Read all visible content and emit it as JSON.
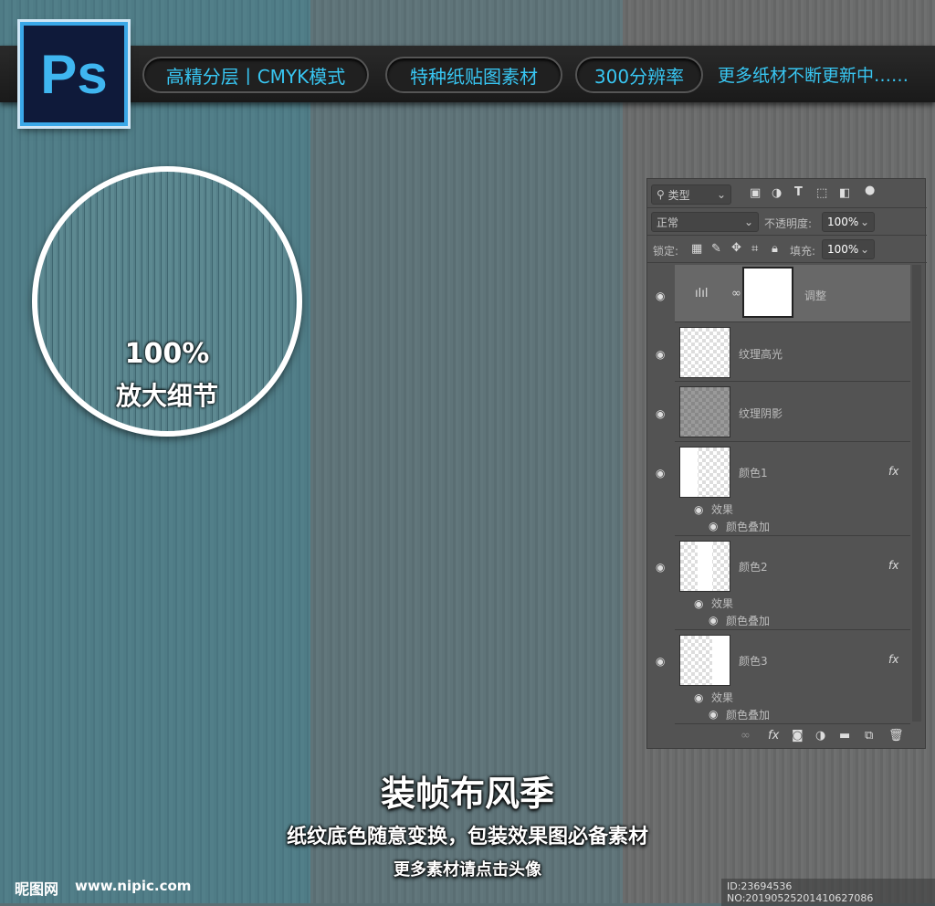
{
  "banner": {
    "logo": "Ps",
    "pills": [
      "高精分层丨CMYK模式",
      "特种纸贴图素材",
      "300分辨率"
    ],
    "tagline": "更多纸材不断更新中……"
  },
  "zoom": {
    "percent": "100%",
    "label": "放大细节"
  },
  "panel": {
    "filter": "类型",
    "blend": "正常",
    "opacity_label": "不透明度:",
    "opacity": "100%",
    "lock_label": "锁定:",
    "fill_label": "填充:",
    "fill": "100%",
    "filter_icons": [
      "image-icon",
      "adjustment-icon",
      "type-icon",
      "shape-icon",
      "smart-object-icon"
    ],
    "layers": [
      {
        "name": "调整",
        "type": "adjustment"
      },
      {
        "name": "纹理高光"
      },
      {
        "name": "纹理阴影"
      },
      {
        "name": "颜色1",
        "fx": "fx",
        "effects_label": "效果",
        "effect": "颜色叠加"
      },
      {
        "name": "颜色2",
        "fx": "fx",
        "effects_label": "效果",
        "effect": "颜色叠加"
      },
      {
        "name": "颜色3",
        "fx": "fx",
        "effects_label": "效果",
        "effect": "颜色叠加"
      }
    ],
    "bottom_icons": [
      "link-icon",
      "fx-icon",
      "mask-icon",
      "adjustment-icon",
      "folder-icon",
      "new-layer-icon",
      "trash-icon"
    ]
  },
  "headline": {
    "title": "装帧布风季",
    "subtitle": "纸纹底色随意变换，包装效果图必备素材",
    "more": "更多素材请点击头像"
  },
  "footer": {
    "brand": "昵图网",
    "url": "www.nipic.com",
    "id": "ID:23694536 NO:20190525201410627086"
  },
  "colors": {
    "accent": "#38c6f2",
    "panel": "#535353"
  }
}
